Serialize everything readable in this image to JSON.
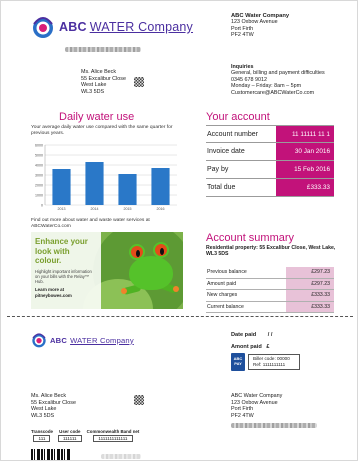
{
  "header": {
    "brand_main": "ABC",
    "brand_sub": "WATER Company"
  },
  "customer": {
    "name": "Ms. Alice Beck",
    "address_line1": "55 Excalibur Close",
    "address_line2": "West Lake",
    "postcode": "WL3 5DS"
  },
  "company": {
    "name": "ABC Water Company",
    "address_line1": "123 Oxbow Avenue",
    "address_line2": "Port Firth",
    "postcode": "PF2 4TW"
  },
  "inquiries": {
    "title": "Inquiries",
    "line1": "General, billing and payment difficulties",
    "phone": "0345 678 9012",
    "hours": "Monday – Friday: 8am – 5pm",
    "email": "Customercare@ABCWaterCo.com"
  },
  "daily_use": {
    "title": "Daily water use",
    "description": "Your average daily water use compared with the same quarter for previous years.",
    "note": "Find out more about water and waste water services at ABCWaterCo.com"
  },
  "chart_data": {
    "type": "bar",
    "categories": [
      "2013",
      "2014",
      "2015",
      "2016"
    ],
    "values": [
      3600,
      4300,
      3100,
      3700
    ],
    "yticks": [
      "0",
      "1000",
      "2000",
      "3000",
      "4000",
      "5000",
      "6000"
    ],
    "ylim": [
      0,
      6000
    ],
    "grid": true,
    "colors": [
      "#2a78c8"
    ]
  },
  "ad": {
    "title": "Enhance your look with colour.",
    "body": "Highlight important information on your bills with the Relay™ Hub.",
    "learn": "Learn more at pitneybowes.com"
  },
  "account": {
    "title": "Your account",
    "rows": [
      {
        "label": "Account number",
        "value": "11 11111 11 1"
      },
      {
        "label": "Invoice date",
        "value": "30 Jan 2016"
      },
      {
        "label": "Pay by",
        "value": "15 Feb 2016"
      },
      {
        "label": "Total due",
        "value": "£333.33"
      }
    ]
  },
  "summary": {
    "title": "Account summary",
    "property": "Residential property: 55 Excalibur Close, West Lake, WL3 5DS",
    "rows": [
      {
        "label": "Previous balance",
        "value": "£297.23"
      },
      {
        "label": "Amount paid",
        "value": "£297.23"
      },
      {
        "label": "New charges",
        "value": "£333.33"
      },
      {
        "label": "Current balance",
        "value": "£333.33"
      }
    ]
  },
  "remittance": {
    "date_paid_label": "Date paid",
    "date_paid_sep": "/        /",
    "amount_paid_label": "Amont paid",
    "currency": "£",
    "bpay_line1": "ABC",
    "bpay_line2": "PAY",
    "biller_code": "Biller code: 00000",
    "ref": "Ref: 1111111111",
    "transcode_label": "Transcode",
    "transcode_value": "111",
    "usercode_label": "User code",
    "usercode_value": "111111",
    "bank_label": "Commonwealth Band net",
    "bank_value": "1111111111111"
  },
  "colors": {
    "accent": "#c2127a",
    "brand": "#4b2fa0",
    "summary_fill": "#e8c2d8",
    "chart_bar": "#2a78c8"
  }
}
